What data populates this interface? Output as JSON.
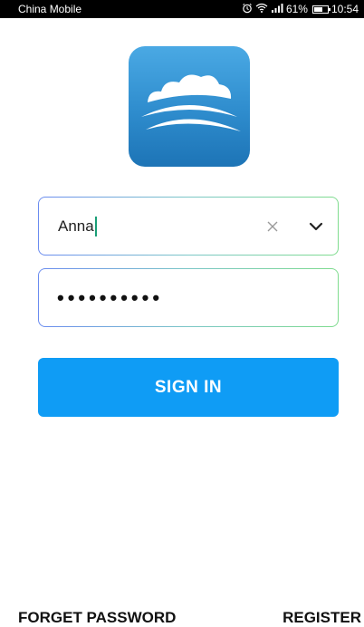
{
  "status_bar": {
    "carrier": "China Mobile",
    "battery_percent": "61%",
    "time": "10:54",
    "icons": [
      "alarm-icon",
      "wifi-icon",
      "signal-icon",
      "battery-icon"
    ]
  },
  "logo": {
    "icon": "cloud-logo-icon",
    "colors": {
      "top": "#4aa9e4",
      "bottom": "#1d74b6"
    }
  },
  "login": {
    "username_value": "Anna",
    "password_mask": "••••••••••",
    "clear_icon": "close-icon",
    "dropdown_icon": "chevron-down-icon",
    "sign_in_label": "SIGN IN"
  },
  "footer": {
    "forget_password": "FORGET PASSWORD",
    "register": "REGISTER"
  },
  "colors": {
    "accent": "#0f9cf5",
    "caret": "#1a9e77"
  }
}
